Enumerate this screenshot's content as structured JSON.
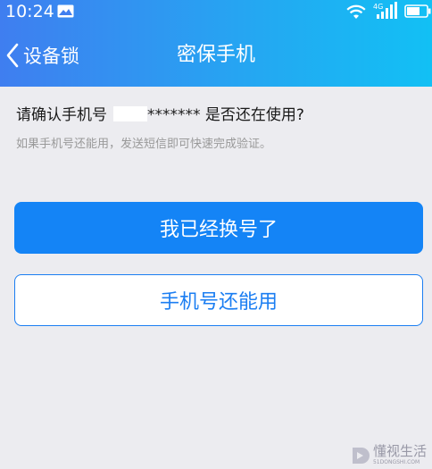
{
  "status_bar": {
    "time": "10:24",
    "network_label": "4G",
    "icons": [
      "notification-icon",
      "wifi-icon",
      "signal-icon",
      "battery-icon"
    ]
  },
  "nav": {
    "back_label": "设备锁",
    "title": "密保手机"
  },
  "content": {
    "confirm_prefix": "请确认手机号",
    "phone_masked": "*******",
    "confirm_suffix": "是否还在使用?",
    "hint": "如果手机号还能用，发送短信即可快速完成验证。"
  },
  "buttons": {
    "changed_number": "我已经换号了",
    "still_usable": "手机号还能用"
  },
  "watermark": {
    "name": "懂视生活",
    "url": "51DONGSHI.COM"
  },
  "colors": {
    "header_gradient_start": "#3f7ef0",
    "header_gradient_end": "#12c0f4",
    "primary_button": "#1484f6",
    "secondary_border": "#1b7ef2",
    "page_background": "#ececf0"
  }
}
